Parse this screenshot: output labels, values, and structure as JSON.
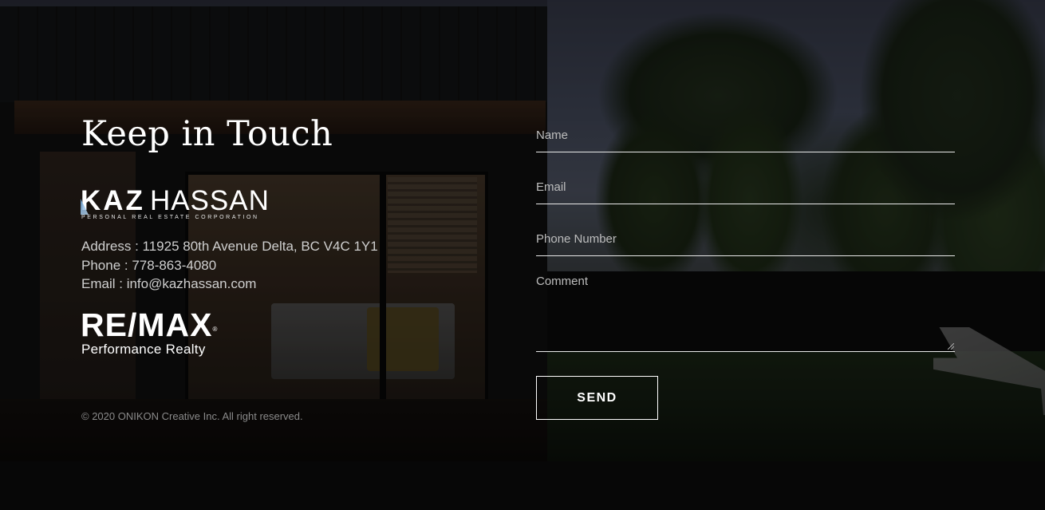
{
  "contact_section": {
    "heading": "Keep in Touch",
    "brand": {
      "name_bold": "KAZ",
      "name_light": "HASSAN",
      "tagline": "PERSONAL REAL ESTATE CORPORATION"
    },
    "address": "Address : 11925 80th Avenue Delta, BC V4C 1Y1",
    "phone": "Phone : 778-863-4080",
    "email_label": "Email : ",
    "email": "info@kazhassan.com",
    "brokerage": {
      "logo_text": "RE/MAX",
      "registered_mark": "®",
      "name": "Performance Realty"
    },
    "copyright": "© 2020 ONIKON Creative Inc. All right reserved."
  },
  "form": {
    "name_label": "Name",
    "email_label": "Email",
    "phone_label": "Phone Number",
    "comment_label": "Comment",
    "send_label": "SEND"
  }
}
